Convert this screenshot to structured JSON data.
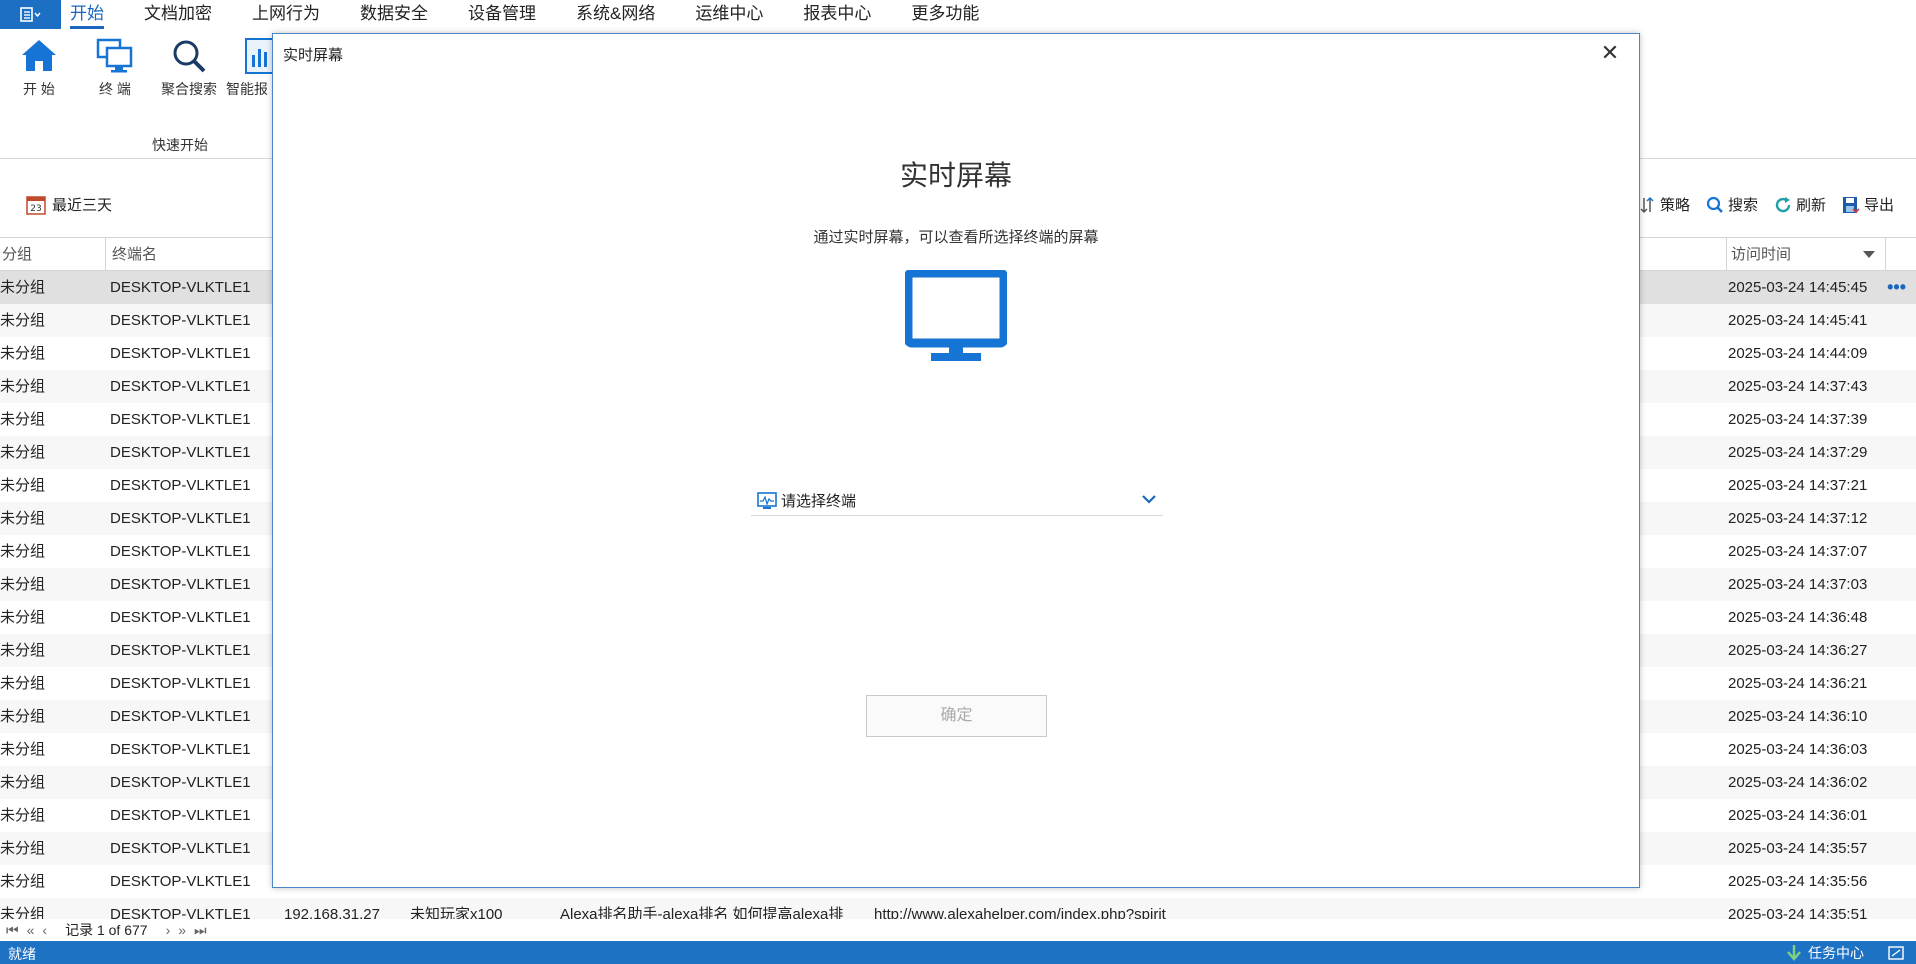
{
  "menu": {
    "app_menu_icon": "app-menu-icon",
    "tabs": [
      "开始",
      "文档加密",
      "上网行为",
      "数据安全",
      "设备管理",
      "系统&网络",
      "运维中心",
      "报表中心",
      "更多功能"
    ],
    "active_tab": "开始"
  },
  "ribbon": {
    "buttons": [
      {
        "label": "开 始",
        "icon": "home-icon"
      },
      {
        "label": "终 端",
        "icon": "terminal-icon"
      },
      {
        "label": "聚合搜索",
        "icon": "search-icon"
      },
      {
        "label": "智能报",
        "icon": "report-icon"
      }
    ],
    "group_label": "快速开始"
  },
  "toolbar": {
    "date_filter": "最近三天",
    "date_icon_text": "23",
    "actions": [
      {
        "label": "策略",
        "icon": "policy-icon"
      },
      {
        "label": "搜索",
        "icon": "search-icon"
      },
      {
        "label": "刷新",
        "icon": "refresh-icon"
      },
      {
        "label": "导出",
        "icon": "export-icon"
      }
    ]
  },
  "grid": {
    "columns": [
      "分组",
      "终端名",
      "访问时间"
    ],
    "rows": [
      {
        "group": "未分组",
        "terminal": "DESKTOP-VLKTLE1",
        "time": "2025-03-24 14:45:45"
      },
      {
        "group": "未分组",
        "terminal": "DESKTOP-VLKTLE1",
        "time": "2025-03-24 14:45:41"
      },
      {
        "group": "未分组",
        "terminal": "DESKTOP-VLKTLE1",
        "time": "2025-03-24 14:44:09"
      },
      {
        "group": "未分组",
        "terminal": "DESKTOP-VLKTLE1",
        "time": "2025-03-24 14:37:43"
      },
      {
        "group": "未分组",
        "terminal": "DESKTOP-VLKTLE1",
        "time": "2025-03-24 14:37:39"
      },
      {
        "group": "未分组",
        "terminal": "DESKTOP-VLKTLE1",
        "time": "2025-03-24 14:37:29"
      },
      {
        "group": "未分组",
        "terminal": "DESKTOP-VLKTLE1",
        "time": "2025-03-24 14:37:21"
      },
      {
        "group": "未分组",
        "terminal": "DESKTOP-VLKTLE1",
        "time": "2025-03-24 14:37:12"
      },
      {
        "group": "未分组",
        "terminal": "DESKTOP-VLKTLE1",
        "time": "2025-03-24 14:37:07"
      },
      {
        "group": "未分组",
        "terminal": "DESKTOP-VLKTLE1",
        "time": "2025-03-24 14:37:03"
      },
      {
        "group": "未分组",
        "terminal": "DESKTOP-VLKTLE1",
        "time": "2025-03-24 14:36:48"
      },
      {
        "group": "未分组",
        "terminal": "DESKTOP-VLKTLE1",
        "time": "2025-03-24 14:36:27"
      },
      {
        "group": "未分组",
        "terminal": "DESKTOP-VLKTLE1",
        "time": "2025-03-24 14:36:21"
      },
      {
        "group": "未分组",
        "terminal": "DESKTOP-VLKTLE1",
        "time": "2025-03-24 14:36:10"
      },
      {
        "group": "未分组",
        "terminal": "DESKTOP-VLKTLE1",
        "time": "2025-03-24 14:36:03"
      },
      {
        "group": "未分组",
        "terminal": "DESKTOP-VLKTLE1",
        "time": "2025-03-24 14:36:02"
      },
      {
        "group": "未分组",
        "terminal": "DESKTOP-VLKTLE1",
        "time": "2025-03-24 14:36:01"
      },
      {
        "group": "未分组",
        "terminal": "DESKTOP-VLKTLE1",
        "time": "2025-03-24 14:35:57"
      },
      {
        "group": "未分组",
        "terminal": "DESKTOP-VLKTLE1",
        "time": "2025-03-24 14:35:56"
      },
      {
        "group": "未分组",
        "terminal": "DESKTOP-VLKTLE1",
        "time": "2025-03-24 14:35:51",
        "ip": "192.168.31.27",
        "user": "未知玩家x100",
        "title": "Alexa排名助手-alexa排名 如何提高alexa排",
        "url": "http://www.alexahelper.com/index.php?spirit"
      }
    ],
    "row_more": "•••"
  },
  "pager": {
    "nav_first": "⏮",
    "nav_prev_page": "«",
    "nav_prev": "‹",
    "record_text": "记录 1 of 677",
    "nav_next": "›",
    "nav_next_page": "»",
    "nav_last": "⏭"
  },
  "status": {
    "left": "就绪",
    "task_center": "任务中心"
  },
  "modal": {
    "title": "实时屏幕",
    "close": "✕",
    "heading": "实时屏幕",
    "description": "通过实时屏幕，可以查看所选择终端的屏幕",
    "select_placeholder": "请选择终端",
    "ok_button": "确定"
  },
  "colors": {
    "accent": "#1b67c0",
    "status_bar": "#1e72c4",
    "monitor": "#1574d4"
  }
}
